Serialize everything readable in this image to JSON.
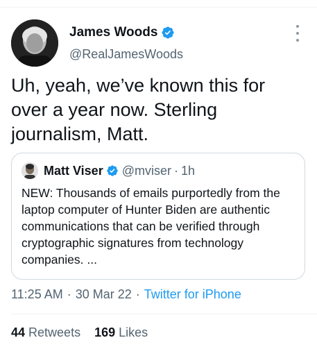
{
  "author": {
    "name": "James Woods",
    "handle": "@RealJamesWoods"
  },
  "tweet": {
    "text": "Uh, yeah, we’ve known this for\nover a year now. Sterling\njournalism, Matt."
  },
  "quoted": {
    "name": "Matt Viser",
    "handle": "@mviser",
    "separator": "·",
    "time": "1h",
    "text": "NEW: Thousands of emails purportedly from the laptop computer of Hunter Biden are authentic communications that can be verified through cryptographic signatures from technology companies. ..."
  },
  "meta": {
    "time": "11:25 AM",
    "dot1": "·",
    "date": "30 Mar 22",
    "dot2": "·",
    "source": "Twitter for iPhone"
  },
  "stats": {
    "retweets_count": "44",
    "retweets_label": "Retweets",
    "likes_count": "169",
    "likes_label": "Likes"
  },
  "colors": {
    "accent": "#1d9bf0",
    "secondary_text": "#536471",
    "primary_text": "#0f1419"
  },
  "icons": {
    "verified": "verified-badge-icon",
    "more": "more-options-icon"
  }
}
